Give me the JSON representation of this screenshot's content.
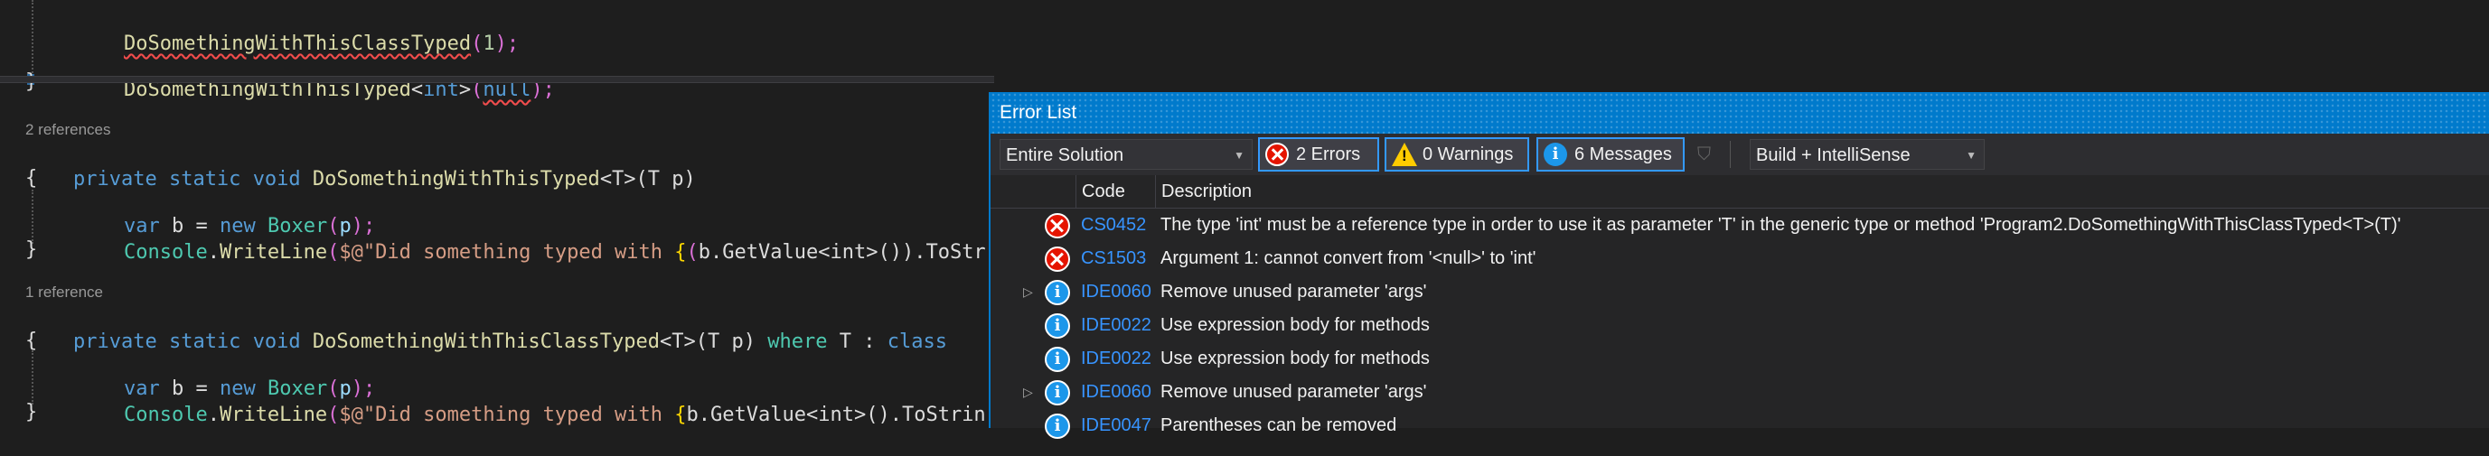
{
  "editor": {
    "codelens_ref2": "2 references",
    "codelens_ref1": "1 reference",
    "lines": {
      "l1": {
        "a": "DoSomethingWithThisClassTyped",
        "b": "(",
        "c": "1",
        "d": ");"
      },
      "l2": {
        "a": "DoSomethingWithThisTyped",
        "b": "<",
        "c": "int",
        "d": ">",
        "e": "(",
        "f": "null",
        "g": ");"
      },
      "l3": {
        "a": "}"
      },
      "l4": {
        "kw1": "private",
        "kw2": "static",
        "kw3": "void",
        "name": "DoSomethingWithThisTyped",
        "sig": "<T>(T p)"
      },
      "l5": {
        "a": "{"
      },
      "l6": {
        "kw": "var",
        "v": " b = ",
        "kw2": "new",
        "t": "Boxer",
        "p1": "(",
        "pp": "p",
        "p2": ");"
      },
      "l7": {
        "t": "Console",
        "dot": ".",
        "m": "WriteLine",
        "p1": "(",
        "s": "$@\"Did something typed with ",
        "b1": "{",
        "p2": "(",
        "rest": "b.GetValue<int>()).ToStr"
      },
      "l8": {
        "a": "}"
      },
      "l9": {
        "kw1": "private",
        "kw2": "static",
        "kw3": "void",
        "name": "DoSomethingWithThisClassTyped",
        "sig": "<T>(T p) ",
        "where": "where",
        "rest": " T : ",
        "cls": "class"
      },
      "l10": {
        "a": "{"
      },
      "l11": {
        "kw": "var",
        "v": " b = ",
        "kw2": "new",
        "t": "Boxer",
        "p1": "(",
        "pp": "p",
        "p2": ");"
      },
      "l12": {
        "t": "Console",
        "dot": ".",
        "m": "WriteLine",
        "p1": "(",
        "s": "$@\"Did something typed with ",
        "b1": "{",
        "rest": "b.GetValue<int>().ToStrin"
      },
      "l13": {
        "a": "}"
      }
    }
  },
  "error_list": {
    "title": "Error List",
    "scope": "Entire Solution",
    "errors_label": "2 Errors",
    "warnings_label": "0 Warnings",
    "messages_label": "6 Messages",
    "build_filter": "Build + IntelliSense",
    "col_code": "Code",
    "col_description": "Description",
    "rows": [
      {
        "code": "CS0452",
        "desc": "The type 'int' must be a reference type in order to use it as parameter 'T' in the generic type or method 'Program2.DoSomethingWithThisClassTyped<T>(T)'"
      },
      {
        "code": "CS1503",
        "desc": "Argument 1: cannot convert from '<null>' to 'int'"
      },
      {
        "code": "IDE0060",
        "desc": "Remove unused parameter 'args'"
      },
      {
        "code": "IDE0022",
        "desc": "Use expression body for methods"
      },
      {
        "code": "IDE0022",
        "desc": "Use expression body for methods"
      },
      {
        "code": "IDE0060",
        "desc": "Remove unused parameter 'args'"
      },
      {
        "code": "IDE0047",
        "desc": "Parentheses can be removed"
      }
    ]
  },
  "colors": {
    "accent": "#007acc",
    "error": "#e51400",
    "info": "#1c97ea"
  }
}
